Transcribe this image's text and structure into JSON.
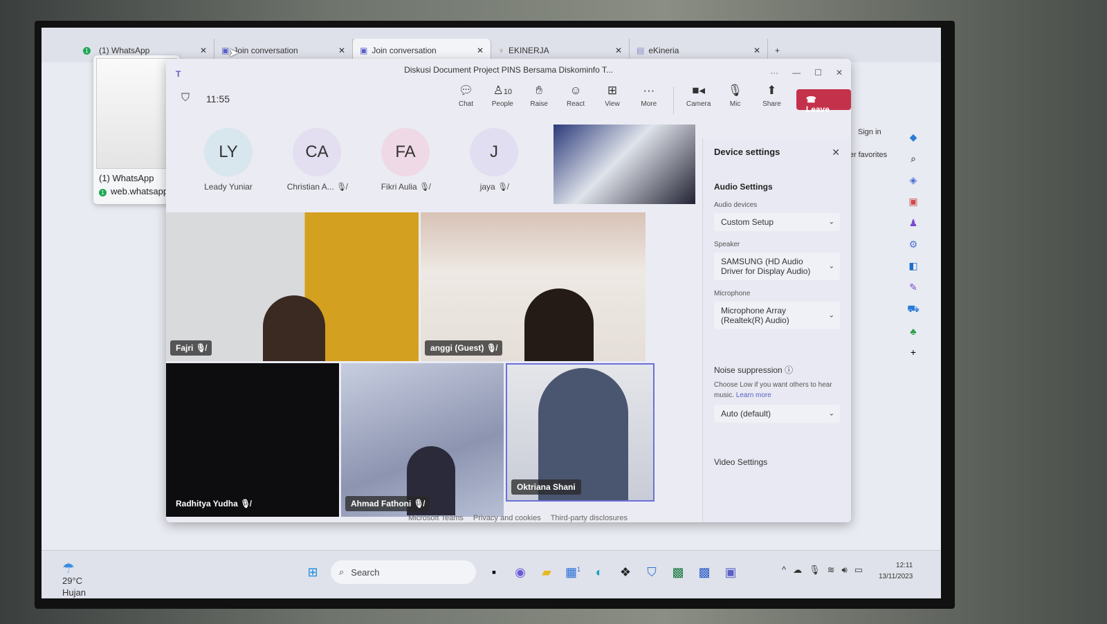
{
  "browser": {
    "tabs": [
      {
        "label": "(1) WhatsApp",
        "badge": "1"
      },
      {
        "label": "Join conversation"
      },
      {
        "label": "Join conversation"
      },
      {
        "label": "EKINERJA"
      },
      {
        "label": "eKineria"
      }
    ],
    "whatsapp_popup": {
      "title": "(1) WhatsApp",
      "url": "web.whatsapp",
      "badge": "1"
    },
    "signin": "Sign in",
    "other_favorites": "Other favorites"
  },
  "teams": {
    "time": "11:55",
    "title": "Diskusi Document Project PINS Bersama Diskominfo T...",
    "toolbar": [
      {
        "label": "Chat",
        "icon": "chat-icon"
      },
      {
        "label": "People",
        "icon": "people-icon",
        "count": "10"
      },
      {
        "label": "Raise",
        "icon": "hand-icon"
      },
      {
        "label": "React",
        "icon": "emoji-icon"
      },
      {
        "label": "View",
        "icon": "view-icon"
      },
      {
        "label": "More",
        "icon": "more-icon"
      },
      {
        "label": "Camera",
        "icon": "camera-icon"
      },
      {
        "label": "Mic",
        "icon": "mic-icon"
      },
      {
        "label": "Share",
        "icon": "share-icon"
      }
    ],
    "leave_label": "Leave",
    "avatars": [
      {
        "initials": "LY",
        "name": "Leady Yuniar",
        "color": "#d8e6ee",
        "muted": false
      },
      {
        "initials": "CA",
        "name": "Christian A...",
        "color": "#e3def0",
        "muted": true
      },
      {
        "initials": "FA",
        "name": "Fikri Aulia",
        "color": "#f0d9e6",
        "muted": true
      },
      {
        "initials": "J",
        "name": "jaya",
        "color": "#e2def2",
        "muted": true
      }
    ],
    "tiles": [
      {
        "name": "Fajri",
        "muted": true
      },
      {
        "name": "anggi (Guest)",
        "muted": true
      },
      {
        "name": "Radhitya Yudha",
        "muted": true
      },
      {
        "name": "Ahmad Fathoni",
        "muted": true
      },
      {
        "name": "Oktriana Shani",
        "muted": false
      }
    ],
    "device_settings": {
      "title": "Device settings",
      "audio_heading": "Audio Settings",
      "audio_devices_label": "Audio devices",
      "audio_devices_value": "Custom Setup",
      "speaker_label": "Speaker",
      "speaker_value": "SAMSUNG (HD Audio Driver for Display Audio)",
      "microphone_label": "Microphone",
      "microphone_value": "Microphone Array (Realtek(R) Audio)",
      "noise_label": "Noise suppression",
      "noise_hint": "Choose Low if you want others to hear music.",
      "learn_more": "Learn more",
      "noise_value": "Auto (default)",
      "video_heading": "Video Settings"
    },
    "footer": [
      "Microsoft Teams",
      "Privacy and cookies",
      "Third-party disclosures"
    ]
  },
  "taskbar": {
    "temperature": "29°C",
    "weather": "Hujan",
    "search_placeholder": "Search",
    "time": "12:11",
    "date": "13/11/2023",
    "store_badge": "1"
  },
  "colors": {
    "teams_accent": "#5b5fc7",
    "leave": "#c4314b"
  }
}
